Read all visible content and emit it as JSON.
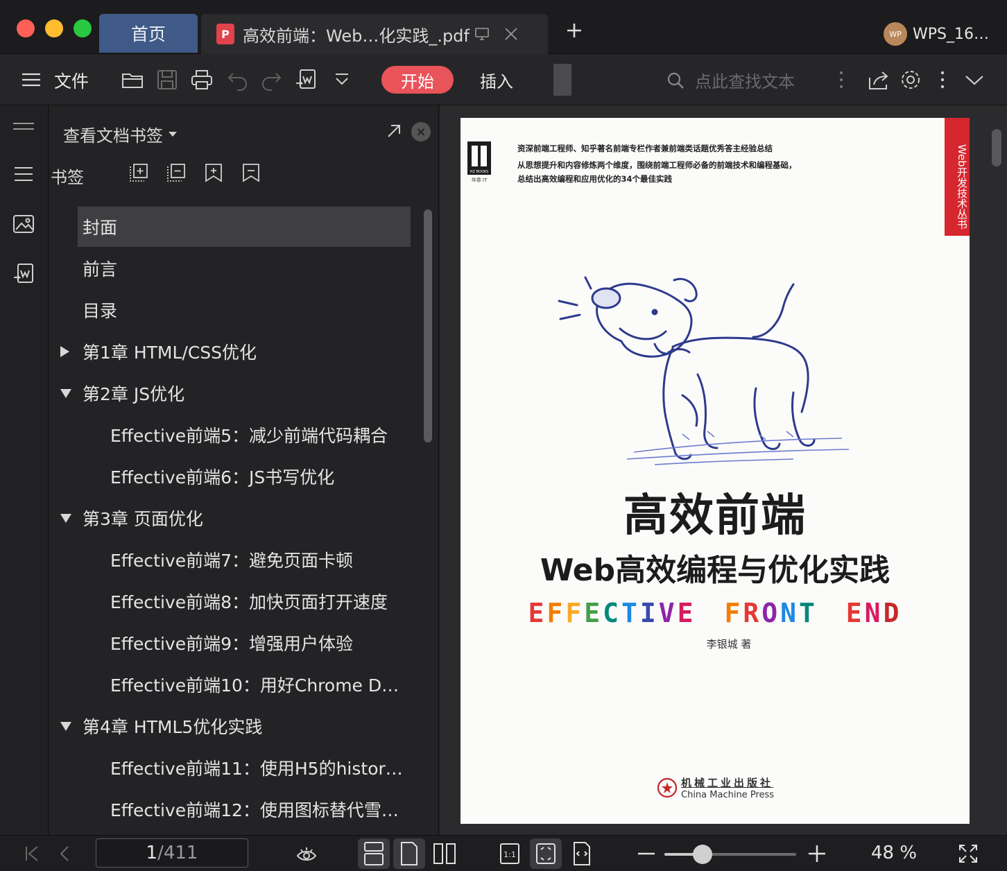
{
  "tabs": {
    "home": "首页",
    "document": "高效前端：Web…化实践_.pdf"
  },
  "account": {
    "name": "WPS_16…",
    "avatar_text": "WP"
  },
  "toolbar": {
    "menu_label": "文件",
    "start_label": "开始",
    "insert_label": "插入",
    "search_placeholder": "点此查找文本"
  },
  "panel": {
    "title": "查看文档书签",
    "bookmarks_label": "书签",
    "items": [
      {
        "label": "封面",
        "level": 1,
        "toggle": "none",
        "selected": true
      },
      {
        "label": "前言",
        "level": 1,
        "toggle": "none"
      },
      {
        "label": "目录",
        "level": 1,
        "toggle": "none"
      },
      {
        "label": "第1章 HTML/CSS优化",
        "level": 1,
        "toggle": "collapsed"
      },
      {
        "label": "第2章 JS优化",
        "level": 1,
        "toggle": "expanded"
      },
      {
        "label": "Effective前端5：减少前端代码耦合",
        "level": 2,
        "toggle": "none"
      },
      {
        "label": "Effective前端6：JS书写优化",
        "level": 2,
        "toggle": "none"
      },
      {
        "label": "第3章 页面优化",
        "level": 1,
        "toggle": "expanded"
      },
      {
        "label": "Effective前端7：避免页面卡顿",
        "level": 2,
        "toggle": "none"
      },
      {
        "label": "Effective前端8：加快页面打开速度",
        "level": 2,
        "toggle": "none"
      },
      {
        "label": "Effective前端9：增强用户体验",
        "level": 2,
        "toggle": "none"
      },
      {
        "label": "Effective前端10：用好Chrome D…",
        "level": 2,
        "toggle": "none"
      },
      {
        "label": "第4章 HTML5优化实践",
        "level": 1,
        "toggle": "expanded"
      },
      {
        "label": "Effective前端11：使用H5的histor…",
        "level": 2,
        "toggle": "none"
      },
      {
        "label": "Effective前端12：使用图标替代雪…",
        "level": 2,
        "toggle": "none"
      }
    ]
  },
  "cover": {
    "publisher_logo": "HZ BOOKS",
    "publisher_logo_sub": "华章 IT",
    "subtitle_lines": [
      "资深前端工程师、知乎著名前端专栏作者兼前端类话题优秀答主经验总结",
      "从思想提升和内容修炼两个维度，围绕前端工程师必备的前端技术和编程基础，",
      "总结出高效编程和应用优化的34个最佳实践"
    ],
    "series": "Web开发技术丛书",
    "title": "高效前端",
    "title2": "Web高效编程与优化实践",
    "english_title_letters": [
      {
        "ch": "E",
        "color": "#e53935"
      },
      {
        "ch": "F",
        "color": "#f57c00"
      },
      {
        "ch": "F",
        "color": "#f9a825"
      },
      {
        "ch": "E",
        "color": "#43a047"
      },
      {
        "ch": "C",
        "color": "#00897b"
      },
      {
        "ch": "T",
        "color": "#1e88e5"
      },
      {
        "ch": "I",
        "color": "#3949ab"
      },
      {
        "ch": "V",
        "color": "#8e24aa"
      },
      {
        "ch": "E",
        "color": "#d81b60"
      },
      {
        "ch": " ",
        "color": "#000000"
      },
      {
        "ch": "F",
        "color": "#f57c00"
      },
      {
        "ch": "R",
        "color": "#e53935"
      },
      {
        "ch": "O",
        "color": "#8e24aa"
      },
      {
        "ch": "N",
        "color": "#1e88e5"
      },
      {
        "ch": "T",
        "color": "#00897b"
      },
      {
        "ch": " ",
        "color": "#000000"
      },
      {
        "ch": "E",
        "color": "#e53935"
      },
      {
        "ch": "N",
        "color": "#d81b60"
      },
      {
        "ch": "D",
        "color": "#c62828"
      }
    ],
    "author": "李银城 著",
    "press_cn": "机械工业出版社",
    "press_en": "China Machine Press"
  },
  "status": {
    "current_page": "1",
    "total_pages": "/411",
    "zoom": "48 %",
    "zoom_level": 0.29
  },
  "colors": {
    "accent_start": "#e9545a",
    "home_tab": "#3f5a86",
    "pdf_icon": "#e0434b"
  }
}
